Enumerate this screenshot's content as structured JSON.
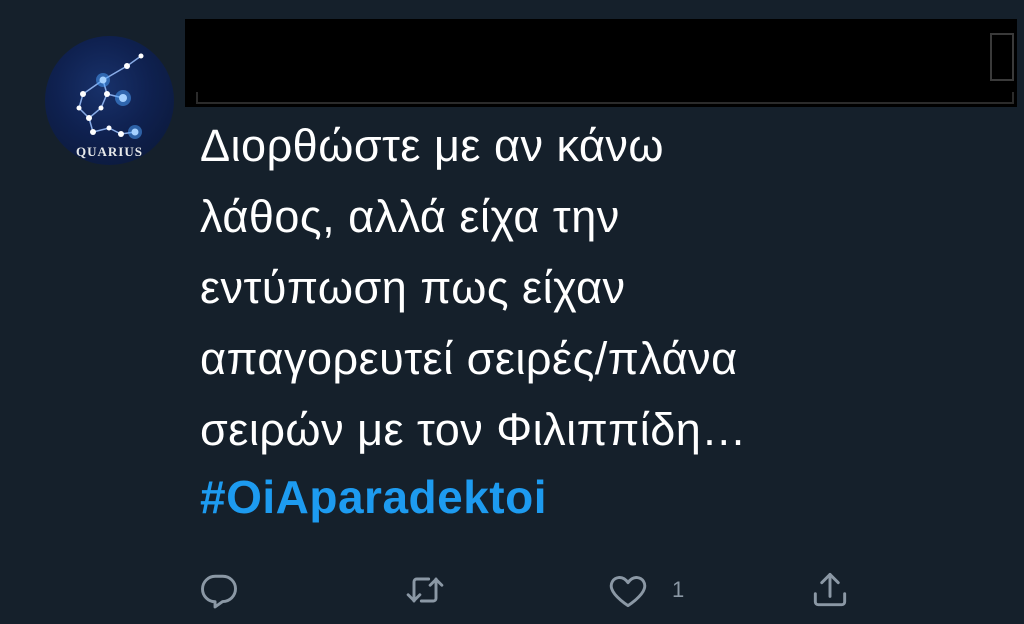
{
  "profile": {
    "avatar_label": "QUARIUS",
    "avatar_icon": "aquarius-constellation"
  },
  "tweet": {
    "lines": [
      "Διορθώστε με αν κάνω",
      "λάθος, αλλά είχα την",
      "εντύπωση πως είχαν",
      "απαγορευτεί σειρές/πλάνα",
      "σειρών με τον Φιλιππίδη…"
    ],
    "hashtag": "#OiAparadektoi"
  },
  "actions": {
    "reply_icon": "reply-icon",
    "retweet_icon": "retweet-icon",
    "like_icon": "like-icon",
    "like_count": "1",
    "share_icon": "share-icon"
  },
  "colors": {
    "background": "#15202b",
    "text": "#ffffff",
    "hashtag": "#1d9bf0",
    "icon": "#8b98a5"
  }
}
